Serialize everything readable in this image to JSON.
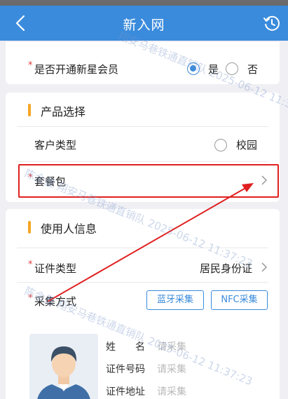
{
  "header": {
    "title": "新入网"
  },
  "star_member": {
    "label": "是否开通新星会员",
    "yes": "是",
    "no": "否",
    "selected": "yes"
  },
  "product_section": {
    "title": "产品选择",
    "customer_type_label": "客户类型",
    "customer_type_option": "校园",
    "package_label": "套餐包"
  },
  "user_section": {
    "title": "使用人信息",
    "id_type_label": "证件类型",
    "id_type_value": "居民身份证",
    "collect_label": "采集方式",
    "bluetooth_button": "蓝牙采集",
    "nfc_button": "NFC采集",
    "name_label": "姓　　名",
    "name_placeholder": "请采集",
    "id_number_label": "证件号码",
    "id_number_placeholder": "请采集",
    "id_address_label": "证件地址",
    "id_address_placeholder": "请采集"
  },
  "watermarks": [
    "翔安马巷铁通直销队 2025-06-12 11:37:23",
    "陈金量 翔安马巷铁通直销队 2025-06-12 11:37:23",
    "陈金量 翔安马巷铁通直销队 2025-06-12 11:37:23"
  ],
  "colors": {
    "primary": "#3a8bdc",
    "accent_bar": "#f5a623",
    "required": "#e23c3c",
    "annotation": "#e02020"
  }
}
